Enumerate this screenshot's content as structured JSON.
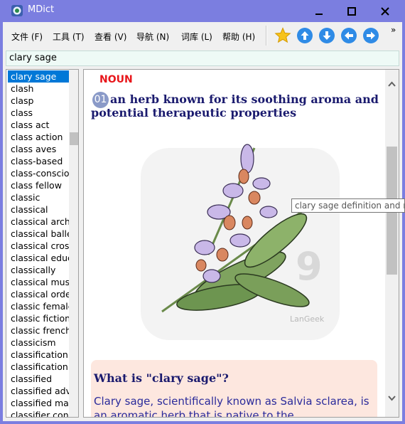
{
  "window": {
    "title": "MDict"
  },
  "menu": {
    "items": [
      "文件 (F)",
      "工具 (T)",
      "查看 (V)",
      "导航 (N)",
      "词库 (L)",
      "帮助 (H)"
    ]
  },
  "toolbar": {
    "buttons": [
      "favorite-star",
      "scroll-up",
      "scroll-down",
      "back",
      "forward"
    ],
    "more": "»"
  },
  "search": {
    "value": "clary sage"
  },
  "wordlist": {
    "items": [
      "clary sage",
      "clash",
      "clasp",
      "class",
      "class act",
      "class action",
      "class aves",
      "class-based",
      "class-consciou",
      "class fellow",
      "classic",
      "classical",
      "classical archi",
      "classical balle",
      "classical cross",
      "classical educ",
      "classically",
      "classical musi",
      "classical orde",
      "classic female",
      "classic fiction",
      "classic french",
      "classicism",
      "classification",
      "classification",
      "classified",
      "classified adv",
      "classified mag",
      "classifier con"
    ],
    "selected_index": 0
  },
  "definition": {
    "part_of_speech": "NOUN",
    "sense_number": "01",
    "text": "an herb known for its soothing aroma and potential therapeutic properties",
    "watermark": "LanGeek",
    "whatis_title": "What is \"clary sage\"?",
    "whatis_text": "Clary sage, scientifically known as Salvia sclarea, is an aromatic herb that is native to the Mediterranean"
  },
  "tooltip": {
    "text": "clary sage definition and m"
  },
  "colors": {
    "titlebar": "#7b7ee0",
    "selection": "#0078d7",
    "pos_red": "#e8161b",
    "definition_navy": "#1a1a6e",
    "whatis_bg": "#fde7df"
  }
}
